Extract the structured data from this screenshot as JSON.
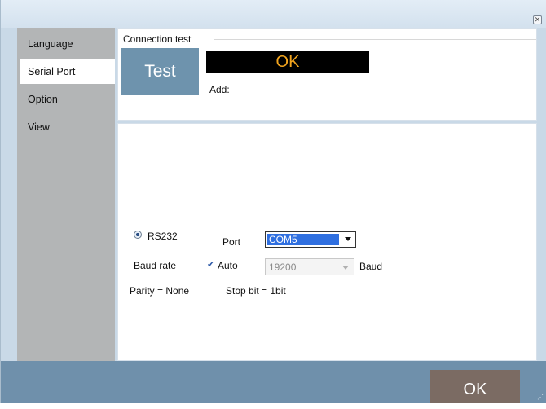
{
  "window": {
    "close_icon": "close-icon"
  },
  "sidebar": {
    "items": [
      {
        "label": "Language",
        "active": false
      },
      {
        "label": "Serial Port",
        "active": true
      },
      {
        "label": "Option",
        "active": false
      },
      {
        "label": "View",
        "active": false
      }
    ]
  },
  "connection_test": {
    "title": "Connection test",
    "test_button": "Test",
    "status": "OK",
    "address_label": "Add:"
  },
  "serial": {
    "rs232_label": "RS232",
    "port_label": "Port",
    "port_value": "COM5",
    "baud_rate_label": "Baud rate",
    "auto_label": "Auto",
    "auto_checked": true,
    "baud_value": "19200",
    "baud_unit": "Baud",
    "parity": "Parity = None",
    "stop_bit": "Stop bit = 1bit"
  },
  "footer": {
    "ok_button": "OK"
  },
  "colors": {
    "status_bg": "#000000",
    "status_text": "#f3a51e",
    "test_button": "#6e93ad",
    "ok_button": "#7b6b63",
    "footer": "#6f90ab",
    "selection": "#2f6fe0"
  }
}
